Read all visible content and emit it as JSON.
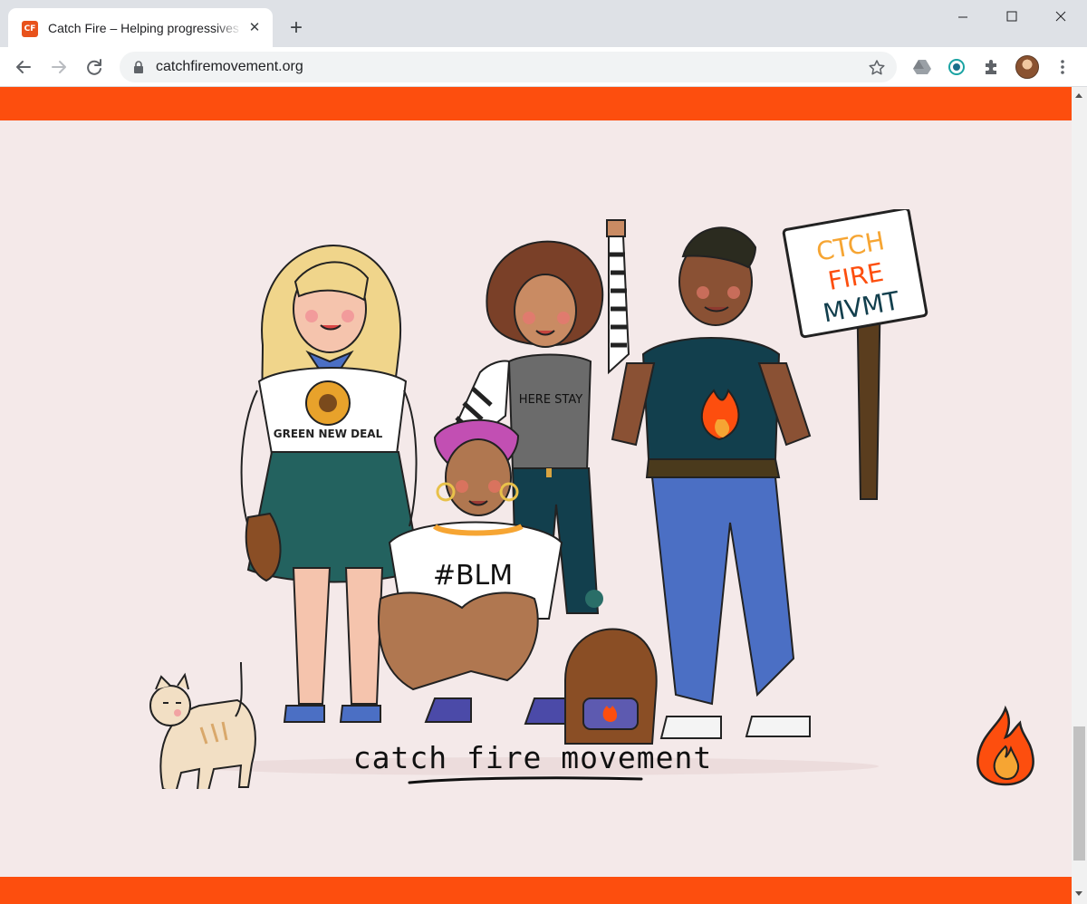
{
  "browser": {
    "tab": {
      "favicon_text": "CF",
      "title": "Catch Fire – Helping progressives"
    },
    "address_bar": {
      "url": "catchfiremovement.org"
    }
  },
  "page": {
    "accent_color": "#fd4e0e",
    "background_color": "#f4e9e9",
    "illustration": {
      "shirt_slogan_green_new_deal": "GREEN NEW DEAL",
      "shirt_slogan_here_to_stay": "HERE STAY",
      "shirt_slogan_blm": "#BLM",
      "sign_line_1": "CTCH",
      "sign_line_2": "FIRE",
      "sign_line_3": "MVMT"
    },
    "wordmark": "catch fire movement"
  },
  "icons": {
    "back": "back-arrow-icon",
    "forward": "forward-arrow-icon",
    "reload": "reload-icon",
    "lock": "lock-icon",
    "bookmark": "star-icon",
    "drive": "drive-icon",
    "extension": "record-extension-icon",
    "extensions": "puzzle-icon",
    "menu": "kebab-menu-icon",
    "flame": "flame-icon"
  }
}
